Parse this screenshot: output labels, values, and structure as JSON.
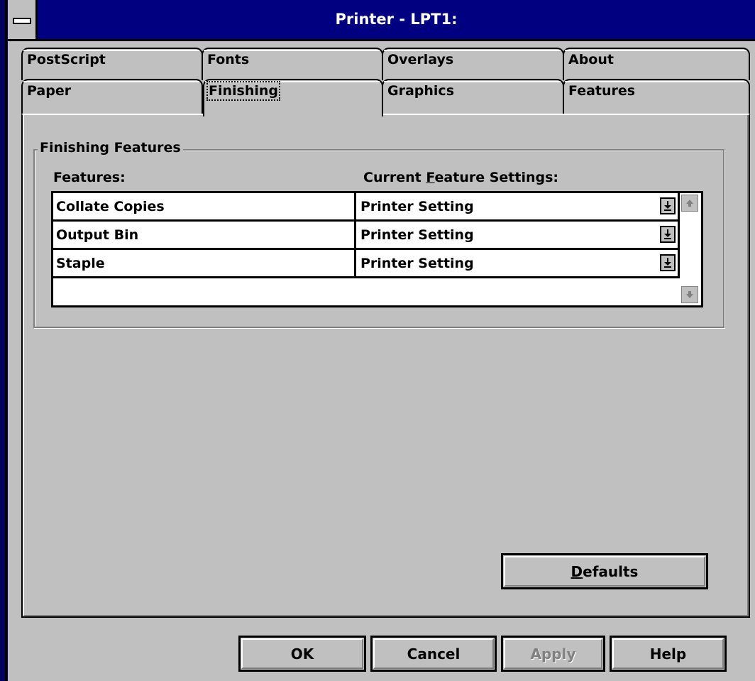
{
  "window": {
    "title": "Printer - LPT1:"
  },
  "tabs_top": [
    {
      "label": "PostScript"
    },
    {
      "label": "Fonts"
    },
    {
      "label": "Overlays"
    },
    {
      "label": "About"
    }
  ],
  "tabs_bottom": [
    {
      "label": "Paper"
    },
    {
      "label": "Finishing",
      "active": true
    },
    {
      "label": "Graphics"
    },
    {
      "label": "Features"
    }
  ],
  "group": {
    "title": "Finishing Features",
    "features_header": "Features:",
    "settings_header_pre": "Current ",
    "settings_header_mnemonic": "F",
    "settings_header_post": "eature Settings:"
  },
  "rows": [
    {
      "feature": "Collate Copies",
      "setting": "Printer Setting"
    },
    {
      "feature": "Output Bin",
      "setting": "Printer Setting"
    },
    {
      "feature": "Staple",
      "setting": "Printer Setting"
    }
  ],
  "buttons": {
    "defaults_mnemonic": "D",
    "defaults_rest": "efaults",
    "ok": "OK",
    "cancel": "Cancel",
    "apply": "Apply",
    "help": "Help"
  },
  "colors": {
    "titlebar": "#000080",
    "face": "#c0c0c0"
  }
}
